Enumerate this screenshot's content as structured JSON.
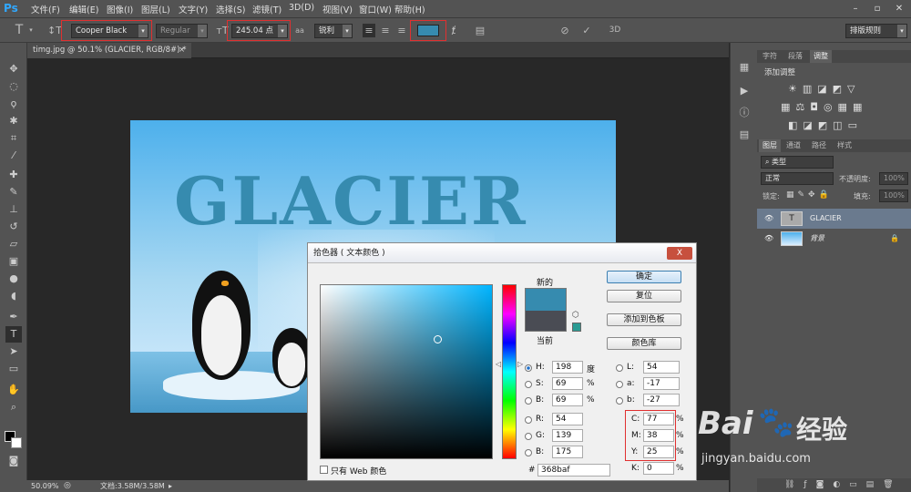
{
  "app": {
    "logo": "Ps"
  },
  "menu": [
    "文件(F)",
    "编辑(E)",
    "图像(I)",
    "图层(L)",
    "文字(Y)",
    "选择(S)",
    "滤镜(T)",
    "3D(D)",
    "视图(V)",
    "窗口(W)",
    "帮助(H)"
  ],
  "options": {
    "font_family": "Cooper Black",
    "font_style": "Regular",
    "font_size": "245.04 点",
    "aa_label": "aa",
    "aa_mode": "锐利",
    "color": "#368baf",
    "threeD": "3D",
    "workspace": "排版规则"
  },
  "doc_tab": {
    "title": "timg.jpg @ 50.1% (GLACIER, RGB/8#) *",
    "close": "×"
  },
  "canvas": {
    "text": "GLACIER",
    "text_color": "#368baf"
  },
  "status": {
    "zoom": "50.09%",
    "doc": "文档:3.58M/3.58M"
  },
  "panel_tabs_top": [
    "字符",
    "段落",
    "调整"
  ],
  "adjust_title": "添加调整",
  "panel_tabs_layers": [
    "图层",
    "通道",
    "路径",
    "样式"
  ],
  "layers_controls": {
    "kind": "类型",
    "blend": "正常",
    "opacity_label": "不透明度:",
    "opacity": "100%",
    "lock_label": "锁定:",
    "fill_label": "填充:",
    "fill": "100%"
  },
  "layers": [
    {
      "name": "GLACIER",
      "type": "T"
    },
    {
      "name": "背景",
      "type": "image"
    }
  ],
  "dialog": {
    "title": "拾色器 ( 文本颜色 )",
    "close": "X",
    "new_label": "新的",
    "current_label": "当前",
    "new_color": "#368baf",
    "current_color": "#4a4c54",
    "buttons": {
      "ok": "确定",
      "reset": "复位",
      "add_swatch": "添加到色板",
      "libraries": "颜色库"
    },
    "hsb": {
      "H": "198",
      "S": "69",
      "B": "69"
    },
    "hsb_units": {
      "H": "度",
      "S": "%",
      "B": "%"
    },
    "rgb": {
      "R": "54",
      "G": "139",
      "B": "175"
    },
    "lab": {
      "L": "54",
      "a": "-17",
      "b": "-27"
    },
    "cmyk": {
      "C": "77",
      "M": "38",
      "Y": "25",
      "K": "0"
    },
    "hex_label": "#",
    "hex": "368baf",
    "web_only": "只有 Web 颜色"
  },
  "watermark": {
    "brand": "Bai",
    "brand2": "经验",
    "url": "jingyan.baidu.com"
  }
}
